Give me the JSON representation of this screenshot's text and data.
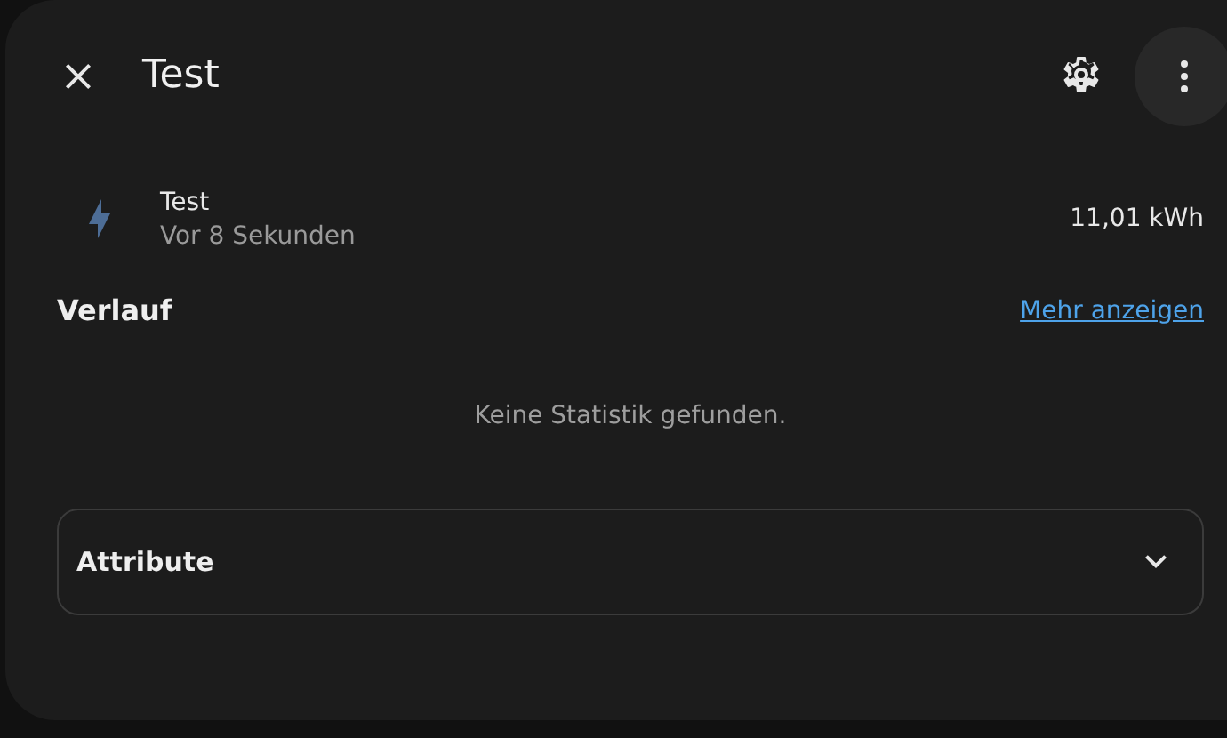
{
  "dialog": {
    "title": "Test"
  },
  "entity": {
    "name": "Test",
    "last_changed": "Vor 8 Sekunden",
    "state": "11,01 kWh"
  },
  "history": {
    "title": "Verlauf",
    "link": "Mehr anzeigen",
    "empty_message": "Keine Statistik gefunden."
  },
  "attributes": {
    "label": "Attribute",
    "expanded": false
  }
}
